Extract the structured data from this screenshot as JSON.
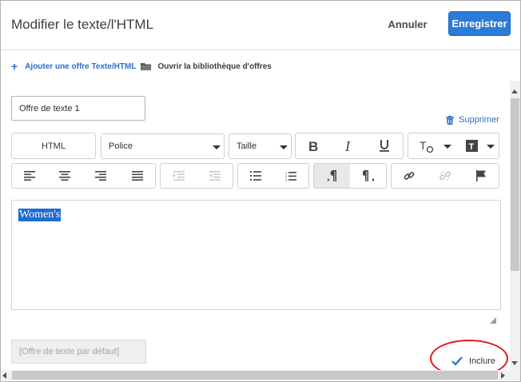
{
  "dialog": {
    "title": "Modifier le texte/l'HTML",
    "cancel_label": "Annuler",
    "save_label": "Enregistrer"
  },
  "actions": {
    "add_label": "Ajouter une offre Texte/HTML",
    "library_label": "Ouvrir la bibliothèque d'offres"
  },
  "offer": {
    "name_value": "Offre de texte 1",
    "delete_label": "Supprimer"
  },
  "toolbar": {
    "html_label": "HTML",
    "font_label": "Police",
    "size_label": "Taille"
  },
  "editor": {
    "content": "Women's"
  },
  "default_offer": {
    "placeholder": "[Offre de texte par défaut]"
  },
  "include": {
    "label": "Inclure",
    "checked": true
  },
  "colors": {
    "accent": "#2d7bd9",
    "link": "#2d6ec8",
    "highlight": "#e0161b"
  }
}
